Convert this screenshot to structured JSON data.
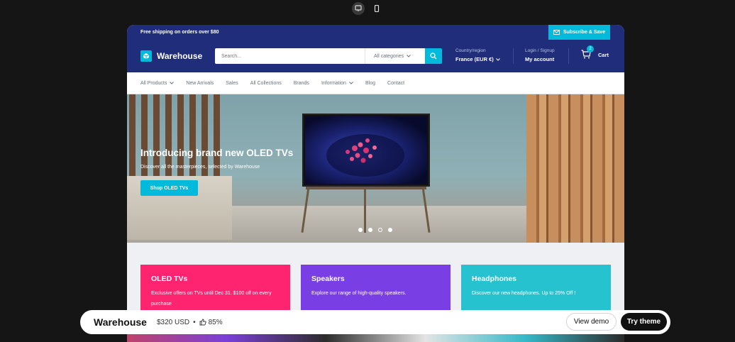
{
  "device_switch": {
    "desktop_icon": "monitor-icon",
    "mobile_icon": "phone-icon"
  },
  "announcement": {
    "text": "Free shipping on orders over $80",
    "subscribe_label": "Subscribe & Save"
  },
  "header": {
    "logo_text": "Warehouse",
    "search_placeholder": "Search...",
    "category_label": "All categories",
    "country_label": "Country/region",
    "country_value": "France (EUR €)",
    "login_label": "Login / Signup",
    "account_label": "My account",
    "cart_count": "2",
    "cart_label": "Cart"
  },
  "nav": {
    "items": [
      "All Products",
      "New Arrivals",
      "Sales",
      "All Collections",
      "Brands",
      "Information",
      "Blog",
      "Contact"
    ]
  },
  "hero": {
    "title": "Introducing brand new OLED TVs",
    "subtitle": "Discover all the masterpieces, selected by Warehouse",
    "button_label": "Shop OLED TVs"
  },
  "cards": [
    {
      "title": "OLED TVs",
      "desc": "Exclusive offers on TVs until Dec 31. $100 off on every purchase",
      "color": "#ff2470"
    },
    {
      "title": "Speakers",
      "desc": "Explore our range of high-quality speakers.",
      "color": "#7a3fe4"
    },
    {
      "title": "Headphones",
      "desc": "Discover our new headphones. Up to 25% Off !",
      "color": "#27c2d0"
    }
  ],
  "colors": {
    "primary": "#1f2d7a",
    "accent": "#00badb"
  },
  "bottom_bar": {
    "theme_name": "Warehouse",
    "price": "$320 USD",
    "separator": "•",
    "rating": "85%",
    "view_demo_label": "View demo",
    "try_theme_label": "Try theme"
  }
}
